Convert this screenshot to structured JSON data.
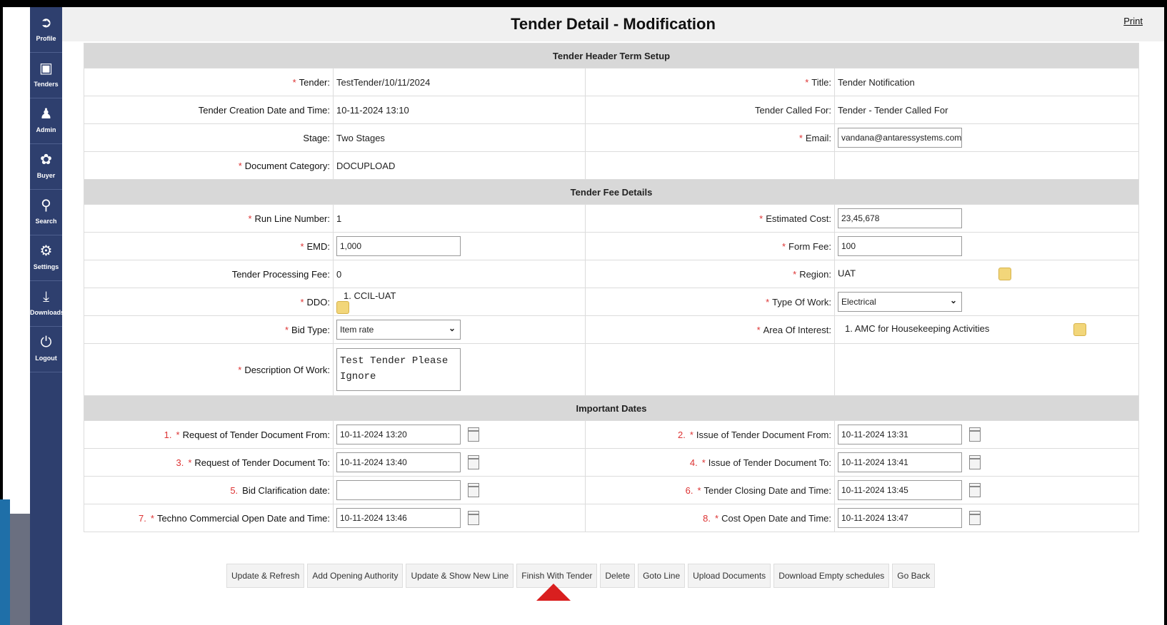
{
  "sidebar": {
    "items": [
      {
        "label": "Profile",
        "icon": "profile-icon",
        "glyph": "➲"
      },
      {
        "label": "Tenders",
        "icon": "tenders-icon",
        "glyph": "▣"
      },
      {
        "label": "Admin",
        "icon": "admin-icon",
        "glyph": "♟"
      },
      {
        "label": "Buyer",
        "icon": "buyer-icon",
        "glyph": "✿"
      },
      {
        "label": "Search",
        "icon": "search-icon",
        "glyph": "⚲"
      },
      {
        "label": "Settings",
        "icon": "settings-icon",
        "glyph": "⚙"
      },
      {
        "label": "Downloads",
        "icon": "download-icon",
        "glyph": "⤓"
      },
      {
        "label": "Logout",
        "icon": "power-icon",
        "glyph": "⏻"
      }
    ]
  },
  "header": {
    "title": "Tender Detail - Modification",
    "print": "Print"
  },
  "sections": {
    "header_terms": "Tender Header Term Setup",
    "fee": "Tender Fee Details",
    "dates": "Important Dates"
  },
  "fields": {
    "tender": {
      "label": "Tender:",
      "value": "TestTender/10/11/2024"
    },
    "title": {
      "label": "Title:",
      "value": "Tender Notification"
    },
    "creation": {
      "label": "Tender Creation Date and Time:",
      "value": "10-11-2024 13:10"
    },
    "called_for": {
      "label": "Tender Called For:",
      "value": "Tender - Tender Called For"
    },
    "stage": {
      "label": "Stage:",
      "value": "Two Stages"
    },
    "email": {
      "label": "Email:",
      "value": "vandana@antaressystems.com"
    },
    "doc_category": {
      "label": "Document Category:",
      "value": "DOCUPLOAD"
    },
    "run_line": {
      "label": "Run Line Number:",
      "value": "1"
    },
    "est_cost": {
      "label": "Estimated Cost:",
      "value": "23,45,678"
    },
    "emd": {
      "label": "EMD:",
      "value": "1,000"
    },
    "form_fee": {
      "label": "Form Fee:",
      "value": "100"
    },
    "processing_fee": {
      "label": "Tender Processing Fee:",
      "value": "0"
    },
    "region": {
      "label": "Region:",
      "value": "UAT"
    },
    "ddo": {
      "label": "DDO:",
      "value": "1. CCIL-UAT"
    },
    "type_of_work": {
      "label": "Type Of Work:",
      "value": "Electrical"
    },
    "bid_type": {
      "label": "Bid Type:",
      "value": "Item rate"
    },
    "area": {
      "label": "Area Of Interest:",
      "value": "1. AMC for Housekeeping Activities"
    },
    "description": {
      "label": "Description Of Work:",
      "value": "Test Tender Please\nIgnore"
    }
  },
  "dates": [
    {
      "num": "1.",
      "label": "Request of Tender Document From:",
      "value": "10-11-2024 13:20",
      "req": true
    },
    {
      "num": "2.",
      "label": "Issue of Tender Document From:",
      "value": "10-11-2024 13:31",
      "req": true
    },
    {
      "num": "3.",
      "label": "Request of Tender Document To:",
      "value": "10-11-2024 13:40",
      "req": true
    },
    {
      "num": "4.",
      "label": "Issue of Tender Document To:",
      "value": "10-11-2024 13:41",
      "req": true
    },
    {
      "num": "5.",
      "label": "Bid Clarification date:",
      "value": "",
      "req": false
    },
    {
      "num": "6.",
      "label": "Tender Closing Date and Time:",
      "value": "10-11-2024 13:45",
      "req": true
    },
    {
      "num": "7.",
      "label": "Techno Commercial Open Date and Time:",
      "value": "10-11-2024 13:46",
      "req": true
    },
    {
      "num": "8.",
      "label": "Cost Open Date and Time:",
      "value": "10-11-2024 13:47",
      "req": true
    }
  ],
  "buttons": [
    "Update & Refresh",
    "Add Opening Authority",
    "Update & Show New Line",
    "Finish With Tender",
    "Delete",
    "Goto Line",
    "Upload Documents",
    "Download Empty schedules",
    "Go Back"
  ],
  "required_mark": "*"
}
